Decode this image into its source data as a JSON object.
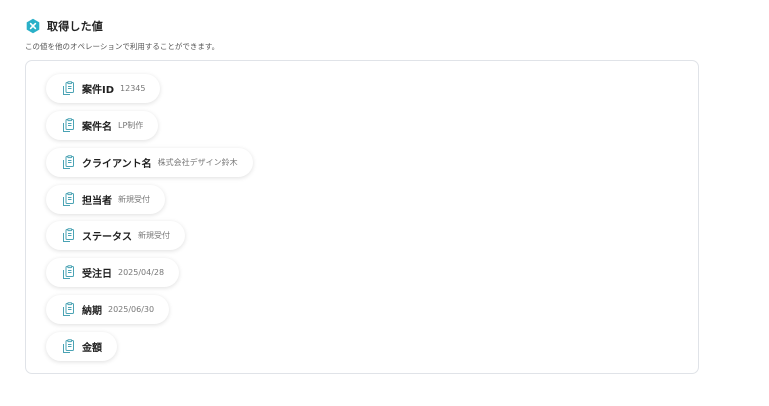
{
  "section": {
    "title": "取得した値",
    "description": "この値を他のオペレーションで利用することができます。"
  },
  "values": [
    {
      "key": "案件ID",
      "value": "12345"
    },
    {
      "key": "案件名",
      "value": "LP制作"
    },
    {
      "key": "クライアント名",
      "value": "株式会社デザイン鈴木"
    },
    {
      "key": "担当者",
      "value": "新規受付"
    },
    {
      "key": "ステータス",
      "value": "新規受付"
    },
    {
      "key": "受注日",
      "value": "2025/04/28"
    },
    {
      "key": "納期",
      "value": "2025/06/30"
    },
    {
      "key": "金額",
      "value": ""
    }
  ],
  "colors": {
    "accent": "#2ab0c8",
    "icon_stroke": "#4aa3b4"
  },
  "icons": {
    "header": "hexagon-x-icon",
    "chip": "clipboard-copy-icon"
  }
}
